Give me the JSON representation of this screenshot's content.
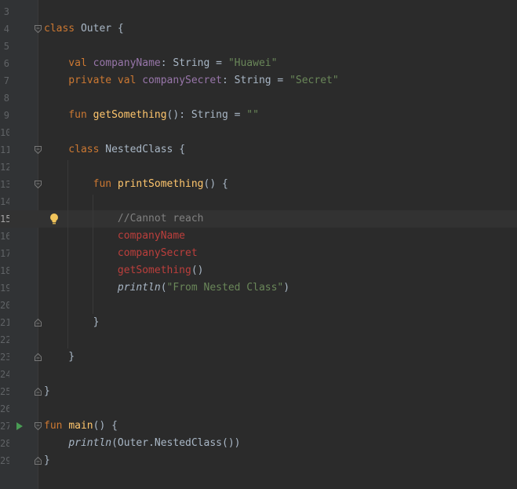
{
  "editor": {
    "language": "kotlin",
    "current_line": "15",
    "lines": [
      {
        "num": "3",
        "tokens": []
      },
      {
        "num": "4",
        "tokens": [
          {
            "t": "class ",
            "c": "kw"
          },
          {
            "t": "Outer {",
            "c": ""
          }
        ]
      },
      {
        "num": "5",
        "tokens": []
      },
      {
        "num": "6",
        "tokens": [
          {
            "t": "    val ",
            "c": "kw"
          },
          {
            "t": "companyName",
            "c": "prop"
          },
          {
            "t": ": String = ",
            "c": ""
          },
          {
            "t": "\"Huawei\"",
            "c": "str"
          }
        ]
      },
      {
        "num": "7",
        "tokens": [
          {
            "t": "    private val ",
            "c": "kw"
          },
          {
            "t": "companySecret",
            "c": "prop"
          },
          {
            "t": ": String = ",
            "c": ""
          },
          {
            "t": "\"Secret\"",
            "c": "str"
          }
        ]
      },
      {
        "num": "8",
        "tokens": []
      },
      {
        "num": "9",
        "tokens": [
          {
            "t": "    fun ",
            "c": "kw"
          },
          {
            "t": "getSomething",
            "c": "fn"
          },
          {
            "t": "(): String = ",
            "c": ""
          },
          {
            "t": "\"\"",
            "c": "str"
          }
        ]
      },
      {
        "num": "10",
        "tokens": []
      },
      {
        "num": "11",
        "tokens": [
          {
            "t": "    class ",
            "c": "kw"
          },
          {
            "t": "NestedClass {",
            "c": ""
          }
        ]
      },
      {
        "num": "12",
        "tokens": []
      },
      {
        "num": "13",
        "tokens": [
          {
            "t": "        fun ",
            "c": "kw"
          },
          {
            "t": "printSomething",
            "c": "fn"
          },
          {
            "t": "() {",
            "c": ""
          }
        ]
      },
      {
        "num": "14",
        "tokens": []
      },
      {
        "num": "15",
        "tokens": [
          {
            "t": "            //Cannot reach",
            "c": "cmt"
          }
        ]
      },
      {
        "num": "16",
        "tokens": [
          {
            "t": "            companyName",
            "c": "err"
          }
        ]
      },
      {
        "num": "17",
        "tokens": [
          {
            "t": "            companySecret",
            "c": "err"
          }
        ]
      },
      {
        "num": "18",
        "tokens": [
          {
            "t": "            getSomething",
            "c": "err"
          },
          {
            "t": "()",
            "c": ""
          }
        ]
      },
      {
        "num": "19",
        "tokens": [
          {
            "t": "            ",
            "c": ""
          },
          {
            "t": "println",
            "c": "ital"
          },
          {
            "t": "(",
            "c": ""
          },
          {
            "t": "\"From Nested Class\"",
            "c": "str"
          },
          {
            "t": ")",
            "c": ""
          }
        ]
      },
      {
        "num": "20",
        "tokens": []
      },
      {
        "num": "21",
        "tokens": [
          {
            "t": "        }",
            "c": ""
          }
        ]
      },
      {
        "num": "22",
        "tokens": []
      },
      {
        "num": "23",
        "tokens": [
          {
            "t": "    }",
            "c": ""
          }
        ]
      },
      {
        "num": "24",
        "tokens": []
      },
      {
        "num": "25",
        "tokens": [
          {
            "t": "}",
            "c": ""
          }
        ]
      },
      {
        "num": "26",
        "tokens": []
      },
      {
        "num": "27",
        "tokens": [
          {
            "t": "fun ",
            "c": "kw"
          },
          {
            "t": "main",
            "c": "fn"
          },
          {
            "t": "() {",
            "c": ""
          }
        ]
      },
      {
        "num": "28",
        "tokens": [
          {
            "t": "    ",
            "c": ""
          },
          {
            "t": "println",
            "c": "ital"
          },
          {
            "t": "(Outer.NestedClass())",
            "c": ""
          }
        ]
      },
      {
        "num": "29",
        "tokens": [
          {
            "t": "}",
            "c": ""
          }
        ]
      }
    ]
  },
  "gutter_icons": {
    "fold_open_lines": [
      "4",
      "11",
      "13"
    ],
    "fold_close_lines": [
      "21",
      "23",
      "25",
      "29"
    ],
    "fold_open_end_lines": [
      "27"
    ],
    "run_lines": [
      "27"
    ],
    "bulb_lines": [
      "15"
    ]
  },
  "colors": {
    "background": "#2b2b2b",
    "keyword": "#cc7832",
    "string": "#6a8759",
    "property": "#9876aa",
    "function": "#ffc66d",
    "error": "#bc3f3c",
    "comment": "#808080",
    "run": "#499c54",
    "bulb": "#f2c55c"
  }
}
